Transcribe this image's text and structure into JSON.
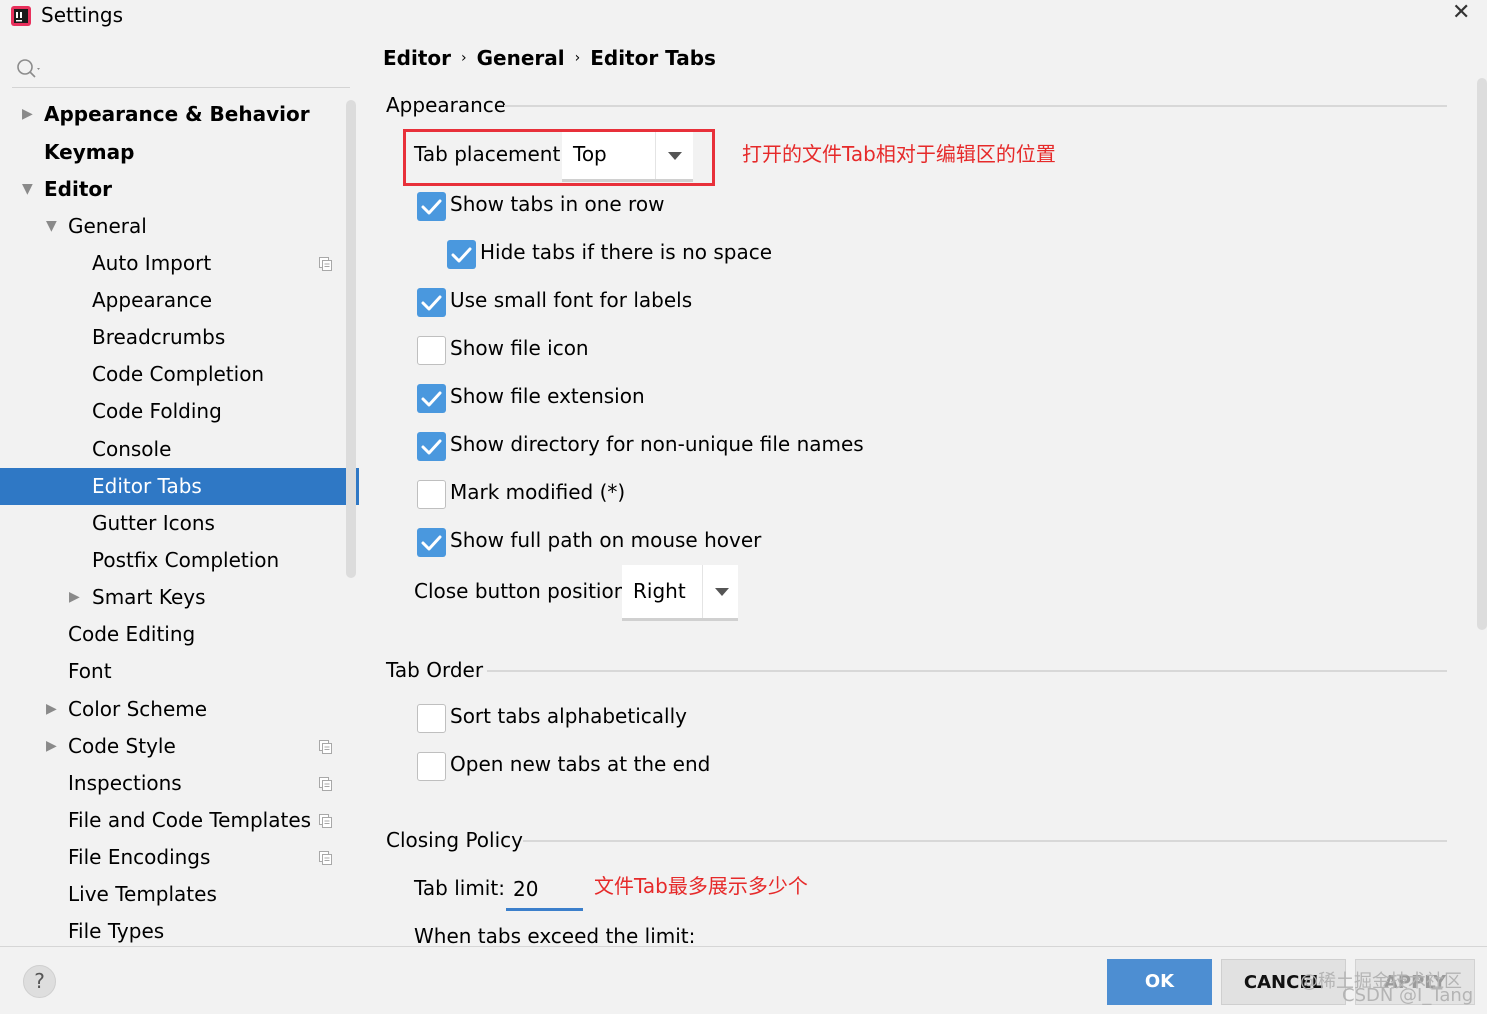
{
  "window": {
    "title": "Settings",
    "close_icon": "close-icon"
  },
  "search": {
    "icon": "search-icon"
  },
  "sidebar": {
    "items": [
      {
        "label": "Appearance & Behavior",
        "level": 0,
        "bold": true,
        "expander": "collapsed"
      },
      {
        "label": "Keymap",
        "level": 0,
        "bold": true,
        "expander": "none"
      },
      {
        "label": "Editor",
        "level": 0,
        "bold": true,
        "expander": "expanded"
      },
      {
        "label": "General",
        "level": 1,
        "bold": false,
        "expander": "expanded"
      },
      {
        "label": "Auto Import",
        "level": 2,
        "bold": false,
        "expander": "none",
        "project_icon": true
      },
      {
        "label": "Appearance",
        "level": 2,
        "bold": false,
        "expander": "none"
      },
      {
        "label": "Breadcrumbs",
        "level": 2,
        "bold": false,
        "expander": "none"
      },
      {
        "label": "Code Completion",
        "level": 2,
        "bold": false,
        "expander": "none"
      },
      {
        "label": "Code Folding",
        "level": 2,
        "bold": false,
        "expander": "none"
      },
      {
        "label": "Console",
        "level": 2,
        "bold": false,
        "expander": "none"
      },
      {
        "label": "Editor Tabs",
        "level": 2,
        "bold": false,
        "expander": "none",
        "selected": true
      },
      {
        "label": "Gutter Icons",
        "level": 2,
        "bold": false,
        "expander": "none"
      },
      {
        "label": "Postfix Completion",
        "level": 2,
        "bold": false,
        "expander": "none"
      },
      {
        "label": "Smart Keys",
        "level": 2,
        "bold": false,
        "expander": "collapsed"
      },
      {
        "label": "Code Editing",
        "level": 1,
        "bold": false,
        "expander": "none"
      },
      {
        "label": "Font",
        "level": 1,
        "bold": false,
        "expander": "none"
      },
      {
        "label": "Color Scheme",
        "level": 1,
        "bold": false,
        "expander": "collapsed"
      },
      {
        "label": "Code Style",
        "level": 1,
        "bold": false,
        "expander": "collapsed",
        "project_icon": true
      },
      {
        "label": "Inspections",
        "level": 1,
        "bold": false,
        "expander": "none",
        "project_icon": true
      },
      {
        "label": "File and Code Templates",
        "level": 1,
        "bold": false,
        "expander": "none",
        "project_icon": true
      },
      {
        "label": "File Encodings",
        "level": 1,
        "bold": false,
        "expander": "none",
        "project_icon": true
      },
      {
        "label": "Live Templates",
        "level": 1,
        "bold": false,
        "expander": "none"
      },
      {
        "label": "File Types",
        "level": 1,
        "bold": false,
        "expander": "none"
      }
    ]
  },
  "breadcrumb": [
    "Editor",
    "General",
    "Editor Tabs"
  ],
  "appearance_section": {
    "title": "Appearance",
    "tab_placement_label": "Tab placement:",
    "tab_placement_value": "Top",
    "annotation": "打开的文件Tab相对于编辑区的位置",
    "checkboxes": [
      {
        "label": "Show tabs in one row",
        "checked": true,
        "indent": false
      },
      {
        "label": "Hide tabs if there is no space",
        "checked": true,
        "indent": true
      },
      {
        "label": "Use small font for labels",
        "checked": true,
        "indent": false
      },
      {
        "label": "Show file icon",
        "checked": false,
        "indent": false
      },
      {
        "label": "Show file extension",
        "checked": true,
        "indent": false
      },
      {
        "label": "Show directory for non-unique file names",
        "checked": true,
        "indent": false
      },
      {
        "label": "Mark modified (*)",
        "checked": false,
        "indent": false
      },
      {
        "label": "Show full path on mouse hover",
        "checked": true,
        "indent": false
      }
    ],
    "close_button_label": "Close button position:",
    "close_button_value": "Right"
  },
  "tab_order_section": {
    "title": "Tab Order",
    "checkboxes": [
      {
        "label": "Sort tabs alphabetically",
        "checked": false
      },
      {
        "label": "Open new tabs at the end",
        "checked": false
      }
    ]
  },
  "closing_policy_section": {
    "title": "Closing Policy",
    "tab_limit_label": "Tab limit:",
    "tab_limit_value": "20",
    "annotation": "文件Tab最多展示多少个",
    "exceed_label": "When tabs exceed the limit:"
  },
  "footer": {
    "help_label": "?",
    "ok_label": "OK",
    "cancel_label": "CANCEL",
    "apply_label": "APPLY",
    "watermark_1": "@稀土掘金技术社区",
    "watermark_2": "CSDN @I_Tang"
  },
  "colors": {
    "selection": "#2f78c5",
    "checkbox_on": "#4a98de",
    "annotation": "#e62a2a",
    "ok_button": "#4d8ed2"
  }
}
